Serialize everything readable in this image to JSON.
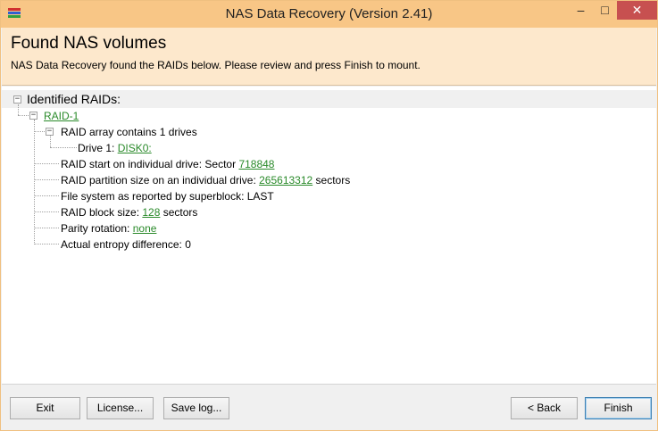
{
  "window": {
    "title": "NAS Data Recovery (Version 2.41)",
    "controls": {
      "minimize": "–",
      "maximize": "□",
      "close": "✕"
    }
  },
  "header": {
    "title": "Found NAS volumes",
    "description": "NAS Data Recovery found the RAIDs below. Please review and press Finish to mount."
  },
  "tree": {
    "root_label": "Identified RAIDs:",
    "raid_name": "RAID-1",
    "array_label": "RAID array contains 1 drives",
    "drive_prefix": "Drive 1:",
    "drive_link": "DISK0:",
    "start_prefix": "RAID start on individual drive: Sector",
    "start_value": "718848",
    "partition_prefix": "RAID partition size on an individual drive:",
    "partition_value": "265613312",
    "partition_suffix": "sectors",
    "filesystem": "File system as reported by superblock: LAST",
    "block_prefix": "RAID block size:",
    "block_value": "128",
    "block_suffix": "sectors",
    "parity_prefix": "Parity rotation:",
    "parity_value": "none",
    "entropy": "Actual entropy difference: 0"
  },
  "buttons": {
    "exit": "Exit",
    "license": "License...",
    "save_log": "Save log...",
    "back": "< Back",
    "finish": "Finish"
  },
  "colors": {
    "titlebar": "#f8c686",
    "header_bg": "#fde8cc",
    "link": "#2a8a2a",
    "close_button": "#c75050"
  },
  "icons": {
    "app": "nas-recovery-app-icon",
    "tree_collapse": "minus-box-icon"
  }
}
